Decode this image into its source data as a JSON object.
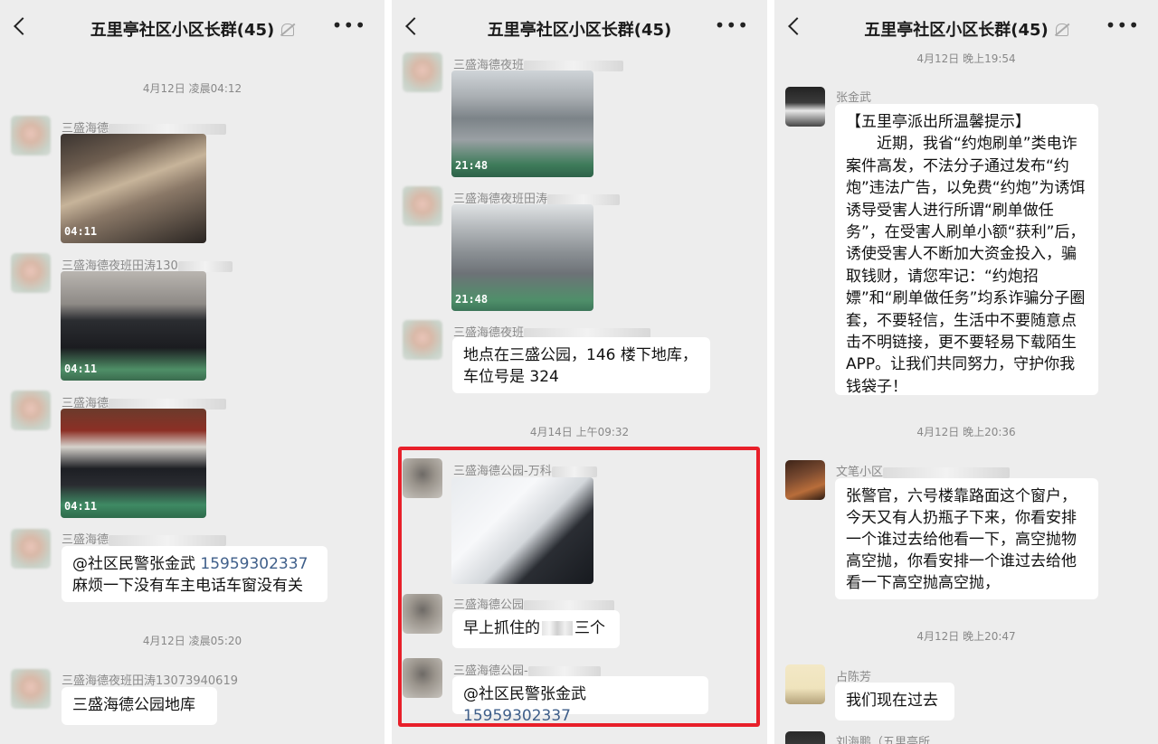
{
  "panels": [
    {
      "title": "五里亭社区小区长群(45)",
      "timestamps": [
        "4月12日 凌晨04:12",
        "4月12日 凌晨05:20"
      ],
      "messages": [
        {
          "sender": "三盛海德",
          "photo_time": "04:11"
        },
        {
          "sender": "三盛海德夜班田涛130",
          "photo_time": "04:11"
        },
        {
          "sender": "三盛海德",
          "photo_time": "04:11"
        },
        {
          "sender": "三盛海德",
          "mention": "@社区民警张金武",
          "phone": "15959302337",
          "text2": "麻烦一下没有车主电话车窗没有关"
        },
        {
          "sender": "三盛海德夜班田涛13073940619",
          "text": "三盛海德公园地库"
        }
      ]
    },
    {
      "title": "五里亭社区小区长群(45)",
      "timestamps": [
        "4月14日 上午09:32"
      ],
      "messages": [
        {
          "sender": "三盛海德夜班",
          "photo_time": "21:48"
        },
        {
          "sender": "三盛海德夜班田涛",
          "photo_time": "21:48"
        },
        {
          "sender": "三盛海德夜班",
          "text": "地点在三盛公园，146 楼下地库，车位号是 324"
        },
        {
          "sender": "三盛海德公园-万科"
        },
        {
          "sender": "三盛海德公园",
          "text_a": "早上抓住的",
          "text_b": "三个"
        },
        {
          "sender": "三盛海德公园-",
          "mention": "@社区民警张金武",
          "phone": "15959302337"
        }
      ]
    },
    {
      "title": "五里亭社区小区长群(45)",
      "timestamps": [
        "4月12日 晚上19:54",
        "4月12日 晚上20:36",
        "4月12日 晚上20:47"
      ],
      "messages": [
        {
          "sender": "张金武",
          "text": "【五里亭派出所温馨提示】\n　　近期，我省“约炮刷单”类电诈案件高发，不法分子通过发布“约炮”违法广告，以免费“约炮”为诱饵诱导受害人进行所谓“刷单做任务”，在受害人刷单小额“获利”后，诱使受害人不断加大资金投入，骗取钱财，请您牢记：“约炮招嫖”和“刷单做任务”均系诈骗分子圈套，不要轻信，生活中不要随意点击不明链接，更不要轻易下载陌生 APP。让我们共同努力，守护你我钱袋子！"
        },
        {
          "sender": "文笔小区",
          "text": "张警官，六号楼靠路面这个窗户，今天又有人扔瓶子下来，你看安排一个谁过去给他看一下，高空抛物高空抛，你看安排一个谁过去给他看一下高空抛高空抛，"
        },
        {
          "sender": "占陈芳",
          "text": "我们现在过去"
        },
        {
          "sender": "刘海鹏（五里亭所"
        }
      ]
    }
  ]
}
